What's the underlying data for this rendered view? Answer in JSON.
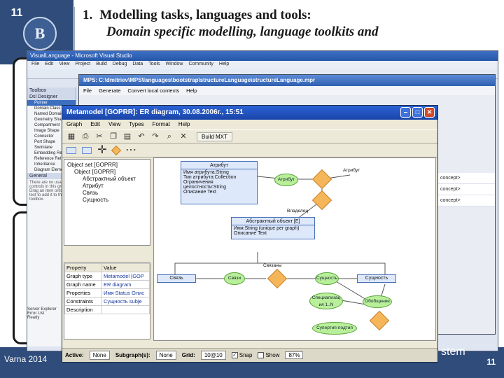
{
  "slide": {
    "number": "11",
    "title_num": "1.",
    "title_main": "Modelling tasks, languages and tools:",
    "title_sub": "Domain specific modelling, language toolkits and",
    "footer_left": "Varna 2014",
    "footer_page": "11",
    "tail_word": "stem",
    "logo_glyph": "В"
  },
  "vs": {
    "title": "VisualLanguage - Microsoft Visual Studio",
    "menu": [
      "File",
      "Edit",
      "View",
      "Project",
      "Build",
      "Debug",
      "Data",
      "Tools",
      "Window",
      "Community",
      "Help"
    ],
    "toolbox_title": "Toolbox",
    "toolbox_group": "Dsl Designer",
    "toolbox_items": [
      "Pointer",
      "Domain Class",
      "Named Domain",
      "Geometry Shape",
      "Compartment",
      "Image Shape",
      "Connector",
      "Port Shape",
      "Swimlane",
      "Embedding Rel.",
      "Reference Rel.",
      "Inheritance",
      "Diagram Element"
    ],
    "toolbox_general": "General",
    "toolbox_note": "There are no usable controls in this group. Drag an item onto this text to add it to the toolbox.",
    "bottom_items": [
      "Server Explorer",
      "Error List",
      "Ready"
    ]
  },
  "mps": {
    "title": "MPS: C:\\dmitriev\\MPS\\languages\\bootstrap\\structureLanguage\\structureLanguage.mpr",
    "menu": [
      "File",
      "Generate",
      "Convert local contexts",
      "Help"
    ],
    "right_items": [
      "concept>",
      "concept>",
      "concept>"
    ]
  },
  "metaedit": {
    "title": "Metamodel [GOPRR]: ER diagram, 30.08.2006г., 15:51",
    "menu": [
      "Graph",
      "Edit",
      "View",
      "Types",
      "Format",
      "Help"
    ],
    "build_label": "Build MXT",
    "tree": {
      "root": "Object set [GOPRR]",
      "child": "Object [GOPRR]",
      "items": [
        "Абстрактный объект",
        "Атрибут",
        "Связь",
        "Сущность"
      ]
    },
    "props": {
      "headers": [
        "Property",
        "Value"
      ],
      "rows": [
        [
          "Graph type",
          "Metamodel [GOP"
        ],
        [
          "Graph name",
          "ER diagram"
        ],
        [
          "Properties",
          "Имя Status Олис"
        ],
        [
          "Constraints",
          "Сущность subje"
        ],
        [
          "Description",
          ""
        ]
      ]
    },
    "diagram": {
      "attr_entity": {
        "title": "Атрибут",
        "lines": [
          "Имя атрибута:String",
          "Тип атрибута:Collection",
          "Ограничения целостности:String",
          "Описание Text"
        ]
      },
      "abstract_entity": {
        "title": "Абстрактный объект [E]",
        "lines": [
          "Имя:String (unique per graph)",
          "Описание Text"
        ]
      },
      "roles": {
        "attr1": "Атрибут",
        "attr2": "Атрибут",
        "owner": "Владелец",
        "link": "Связи",
        "bonds": "Связаны",
        "ent": "Сущность",
        "spec": "Специализац ия 1..N",
        "gen": "Обобщение",
        "super": "Супертип-подтип"
      },
      "link_box": "Связь",
      "entity_box": "Сущность"
    },
    "status": {
      "active_label": "Active:",
      "active_value": "None",
      "subgraph_label": "Subgraph(s):",
      "subgraph_value": "None",
      "grid_label": "Grid:",
      "grid_value": "10@10",
      "snap_label": "Snap",
      "show_label": "Show",
      "zoom_value": "87%"
    }
  }
}
